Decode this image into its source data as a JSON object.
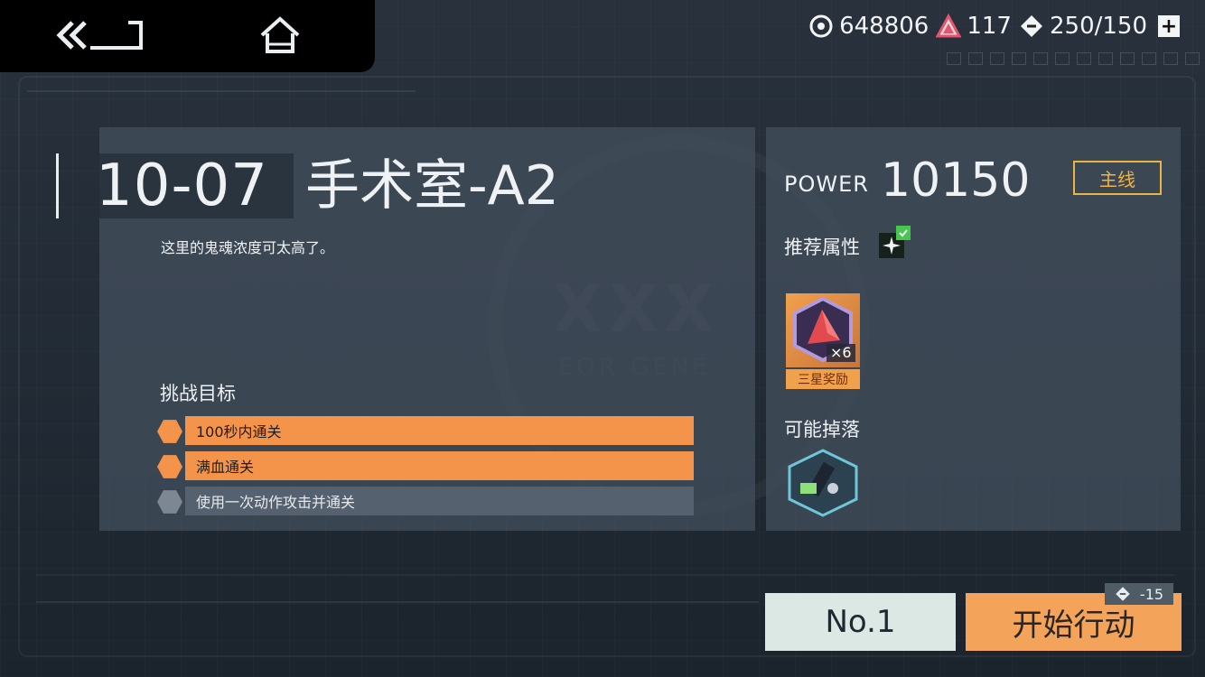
{
  "nav": {
    "back_icon": "double-chevron-back-icon",
    "home_icon": "home-icon"
  },
  "resources": {
    "coins": "648806",
    "crystals": "117",
    "stamina": "250/150",
    "coin_icon": "coin-icon",
    "crystal_icon": "crystal-icon",
    "stamina_icon": "ticket-icon",
    "add_label": "+"
  },
  "stage": {
    "number": "10-07",
    "name": "手术室-A2",
    "description": "这里的鬼魂浓度可太高了。"
  },
  "objectives": {
    "title": "挑战目标",
    "items": [
      {
        "label": "100秒内通关",
        "completed": true
      },
      {
        "label": "满血通关",
        "completed": true
      },
      {
        "label": "使用一次动作攻击并通关",
        "completed": false
      }
    ]
  },
  "info": {
    "power_label": "POWER",
    "power_value": "10150",
    "mainline_tag": "主线",
    "recommended_label": "推荐属性",
    "recommended_icon": "sparkle-attribute-icon",
    "reward_count": "×6",
    "reward_tag": "三星奖励",
    "drop_label": "可能掉落"
  },
  "actions": {
    "rank_label": "No.1",
    "start_label": "开始行动",
    "cost": "-15"
  },
  "colors": {
    "accent_orange": "#f4944a",
    "start_button": "#f4a35a",
    "mainline_gold": "#e9b441",
    "panel": "#424e5c"
  }
}
